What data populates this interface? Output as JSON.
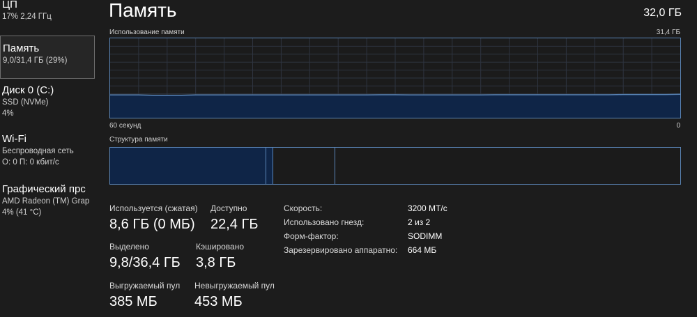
{
  "sidebar": {
    "items": [
      {
        "title": "ЦП",
        "lines": [
          "17% 2,24 ГГц"
        ]
      },
      {
        "title": "Память",
        "lines": [
          "9,0/31,4 ГБ (29%)"
        ]
      },
      {
        "title": "Диск 0 (C:)",
        "lines": [
          "SSD (NVMe)",
          "4%"
        ]
      },
      {
        "title": "Wi-Fi",
        "lines": [
          "Беспроводная сеть",
          "О: 0 П: 0 кбит/с"
        ]
      },
      {
        "title": "Графический прс",
        "lines": [
          "AMD Radeon (TM) Grap",
          "4% (41 °C)"
        ]
      }
    ]
  },
  "header": {
    "title": "Память",
    "total": "32,0 ГБ"
  },
  "graph": {
    "label": "Использование памяти",
    "max_label": "31,4 ГБ",
    "time_left": "60 секунд",
    "time_right": "0",
    "max_gb": 31.4,
    "usage_gb": [
      9.0,
      9.0,
      9.0,
      8.9,
      8.9,
      8.9,
      9.0,
      9.0,
      9.0,
      9.0,
      9.0,
      9.0,
      9.0,
      9.0,
      9.0,
      9.0,
      9.0,
      9.0,
      9.0,
      9.1,
      9.1,
      9.0,
      9.0,
      9.0,
      9.0,
      9.0,
      9.0,
      9.1,
      9.1,
      9.1,
      9.1,
      9.1,
      9.1,
      9.1,
      9.1,
      9.1,
      9.2,
      9.2,
      9.2,
      9.2,
      9.3
    ],
    "line_color": "#5b86b8",
    "fill_color": "#0f2547"
  },
  "composition": {
    "label": "Структура памяти",
    "in_use_gb": 8.6,
    "modified_gb": 0.4,
    "standby_gb": 3.4,
    "total_gb": 31.4
  },
  "stats": {
    "in_use": {
      "label": "Используется (сжатая)",
      "value": "8,6 ГБ (0 МБ)"
    },
    "available": {
      "label": "Доступно",
      "value": "22,4 ГБ"
    },
    "committed": {
      "label": "Выделено",
      "value": "9,8/36,4 ГБ"
    },
    "cached": {
      "label": "Кэшировано",
      "value": "3,8 ГБ"
    },
    "paged_pool": {
      "label": "Выгружаемый пул",
      "value": "385 МБ"
    },
    "nonpaged_pool": {
      "label": "Невыгружаемый пул",
      "value": "453 МБ"
    }
  },
  "details": [
    {
      "label": "Скорость:",
      "value": "3200 МТ/с"
    },
    {
      "label": "Использовано гнезд:",
      "value": "2 из 2"
    },
    {
      "label": "Форм-фактор:",
      "value": "SODIMM"
    },
    {
      "label": "Зарезервировано аппаратно:",
      "value": "664 МБ"
    }
  ]
}
